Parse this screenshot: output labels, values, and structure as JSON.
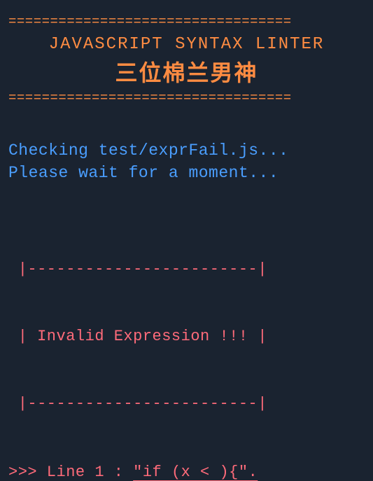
{
  "divider": "==================================",
  "header": {
    "title": "JAVASCRIPT SYNTAX LINTER",
    "subtitle": "三位棉兰男神"
  },
  "status": {
    "line1": "Checking test/exprFail.js...",
    "line2": "Please wait for a moment..."
  },
  "errorBox": {
    "top": " |------------------------|",
    "mid": " | Invalid Expression !!! |",
    "bot": " |------------------------|"
  },
  "pointer": {
    "prefix": ">>> Line 1 : ",
    "code": "\"if (x < ){\"."
  }
}
